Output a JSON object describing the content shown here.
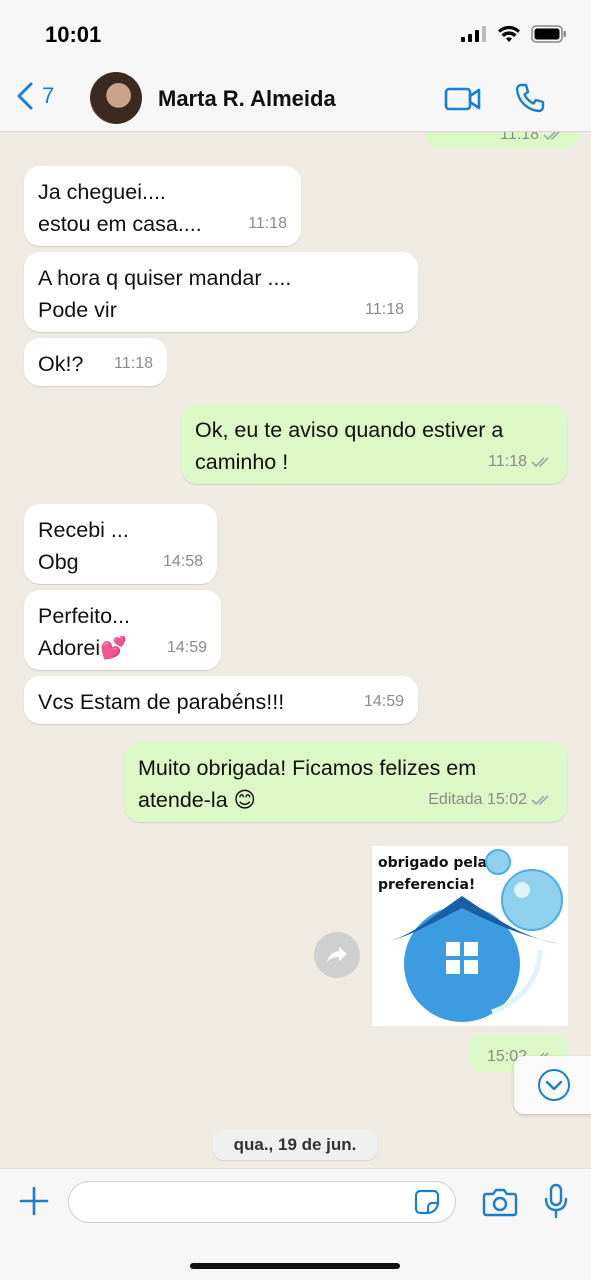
{
  "status_bar": {
    "time": "10:01"
  },
  "header": {
    "back_count": "7",
    "contact_name": "Marta R. Almeida"
  },
  "messages": [
    {
      "text": "Ja cheguei....\nestou em casa....",
      "time": "11:18"
    },
    {
      "text": "A hora q quiser mandar ....\nPode vir",
      "time": "11:18"
    },
    {
      "text": "Ok!?",
      "time": "11:18"
    },
    {
      "text": "Ok, eu te aviso quando estiver a\ncaminho !",
      "time": "11:18"
    },
    {
      "text": "Recebi ...\nObg",
      "time": "14:58"
    },
    {
      "text": "Perfeito...\nAdorei💕",
      "time": "14:59"
    },
    {
      "text": "Vcs Estam de parabéns!!!",
      "time": "14:59"
    },
    {
      "text": "Muito obrigada! Ficamos felizes em\natende-la 😊",
      "time": "Editada 15:02"
    }
  ],
  "partial_message_time": "11:18",
  "image_message": {
    "caption": "obrigado pela\npreferencia!",
    "time": "15:02"
  },
  "date_chip": "qua., 19 de jun.",
  "input": {
    "placeholder": ""
  },
  "colors": {
    "incoming_bubble": "#ffffff",
    "outgoing_bubble": "#dcf8c6",
    "accent": "#1a7fc9",
    "background": "#efeae2"
  },
  "icons": [
    "chevron-left-icon",
    "video-icon",
    "phone-icon",
    "forward-icon",
    "chevron-down-icon",
    "plus-icon",
    "sticker-icon",
    "camera-icon",
    "microphone-icon",
    "double-check-icon"
  ]
}
